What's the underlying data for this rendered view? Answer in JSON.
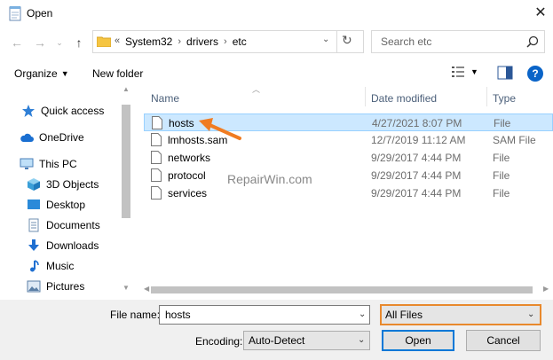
{
  "window": {
    "title": "Open"
  },
  "address": {
    "overflow": "«",
    "crumbs": [
      "System32",
      "drivers",
      "etc"
    ]
  },
  "search": {
    "placeholder": "Search etc"
  },
  "toolbar": {
    "organize_label": "Organize",
    "new_folder_label": "New folder"
  },
  "nav": {
    "items": [
      {
        "label": "Quick access",
        "icon": "star-icon"
      },
      {
        "label": "OneDrive",
        "icon": "cloud-icon"
      },
      {
        "label": "This PC",
        "icon": "computer-icon"
      },
      {
        "label": "3D Objects",
        "icon": "cube-icon"
      },
      {
        "label": "Desktop",
        "icon": "desktop-icon"
      },
      {
        "label": "Documents",
        "icon": "documents-icon"
      },
      {
        "label": "Downloads",
        "icon": "download-icon"
      },
      {
        "label": "Music",
        "icon": "music-icon"
      },
      {
        "label": "Pictures",
        "icon": "pictures-icon"
      }
    ]
  },
  "columns": {
    "name": "Name",
    "date": "Date modified",
    "type": "Type"
  },
  "files": [
    {
      "name": "hosts",
      "date": "4/27/2021 8:07 PM",
      "type": "File",
      "selected": true
    },
    {
      "name": "lmhosts.sam",
      "date": "12/7/2019 11:12 AM",
      "type": "SAM File"
    },
    {
      "name": "networks",
      "date": "9/29/2017 4:44 PM",
      "type": "File"
    },
    {
      "name": "protocol",
      "date": "9/29/2017 4:44 PM",
      "type": "File"
    },
    {
      "name": "services",
      "date": "9/29/2017 4:44 PM",
      "type": "File"
    }
  ],
  "watermark": "RepairWin.com",
  "bottom": {
    "file_name_label": "File name:",
    "file_name_value": "hosts",
    "filter_value": "All Files",
    "encoding_label": "Encoding:",
    "encoding_value": "Auto-Detect",
    "open_label": "Open",
    "cancel_label": "Cancel"
  },
  "colors": {
    "accent": "#0078d7",
    "selection": "#cce8ff",
    "highlight_border": "#e8892d",
    "arrow": "#f07c22",
    "folder": "#f5c542"
  }
}
